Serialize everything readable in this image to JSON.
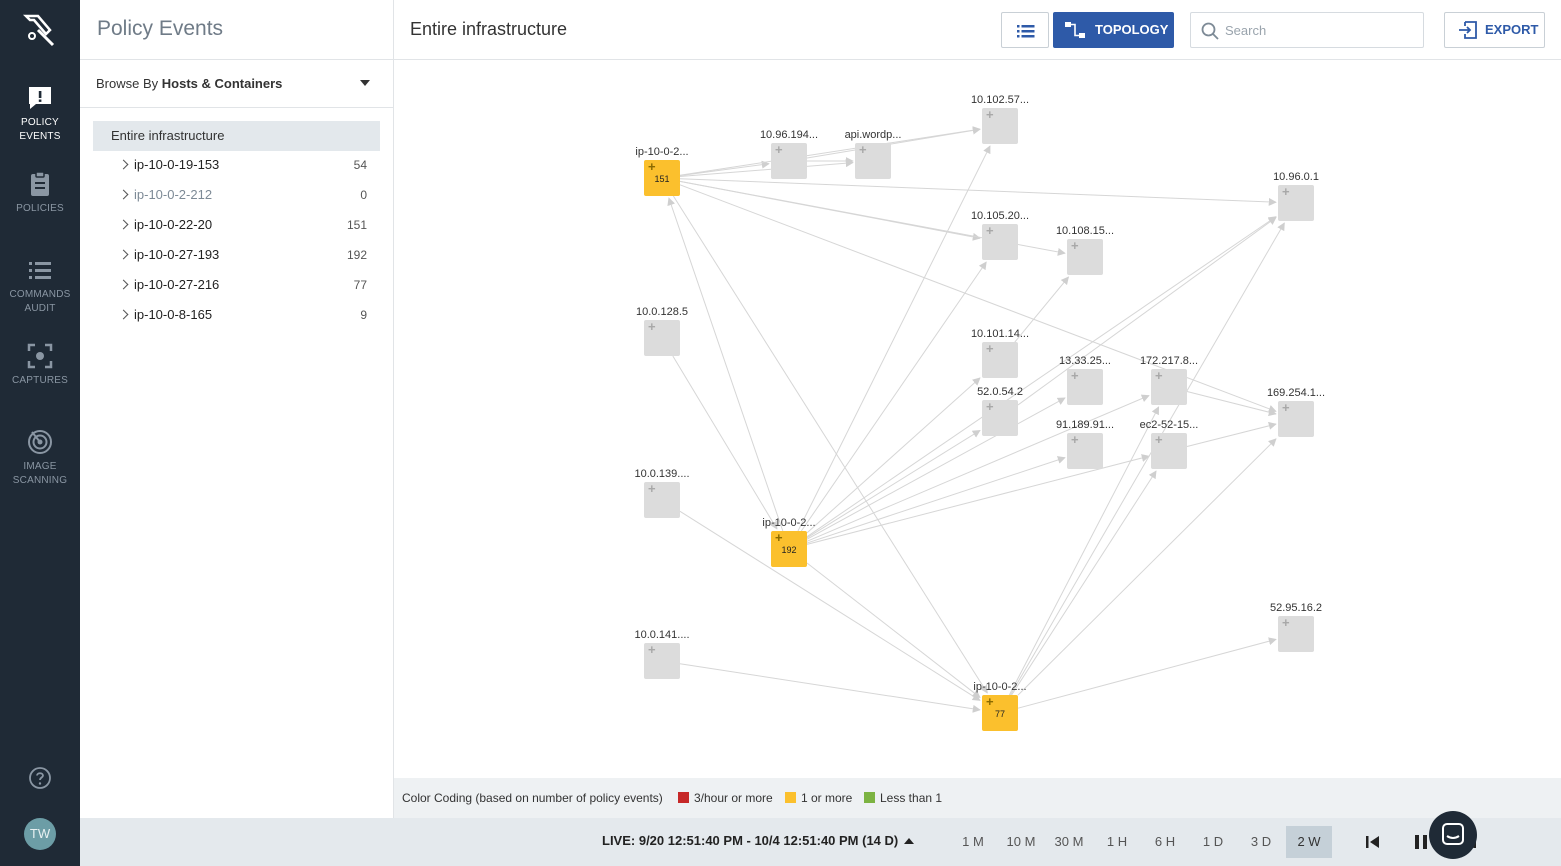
{
  "nav": {
    "items": [
      {
        "label1": "POLICY",
        "label2": "EVENTS",
        "icon": "alert-bubble-icon"
      },
      {
        "label1": "POLICIES",
        "label2": "",
        "icon": "clipboard-icon"
      },
      {
        "label1": "COMMANDS",
        "label2": "AUDIT",
        "icon": "list-icon"
      },
      {
        "label1": "CAPTURES",
        "label2": "",
        "icon": "capture-icon"
      },
      {
        "label1": "IMAGE",
        "label2": "SCANNING",
        "icon": "radar-icon"
      }
    ],
    "avatar": "TW",
    "help_icon": "help-circle-icon"
  },
  "sidebar": {
    "title": "Policy Events",
    "browse_prefix": "Browse By",
    "browse_value": "Hosts & Containers",
    "root": "Entire infrastructure",
    "items": [
      {
        "name": "ip-10-0-19-153",
        "count": "54"
      },
      {
        "name": "ip-10-0-2-212",
        "count": "0"
      },
      {
        "name": "ip-10-0-22-20",
        "count": "151"
      },
      {
        "name": "ip-10-0-27-193",
        "count": "192"
      },
      {
        "name": "ip-10-0-27-216",
        "count": "77"
      },
      {
        "name": "ip-10-0-8-165",
        "count": "9"
      }
    ]
  },
  "header": {
    "breadcrumb": "Entire infrastructure",
    "topology_label": "TOPOLOGY",
    "search_placeholder": "Search",
    "export_label": "EXPORT"
  },
  "colors": {
    "accent": "#2e5aa8",
    "event_node": "#fbc02d",
    "plain_node": "#dcdcdc",
    "red": "#c62828",
    "yellow": "#fbc02d",
    "green": "#7cb342"
  },
  "topology": {
    "nodes": [
      {
        "id": "n1",
        "label": "ip-10-0-2...",
        "count": "151",
        "type": "event"
      },
      {
        "id": "n2",
        "label": "10.96.194...",
        "count": "",
        "type": "plain"
      },
      {
        "id": "n3",
        "label": "api.wordp...",
        "count": "",
        "type": "plain"
      },
      {
        "id": "n4",
        "label": "10.102.57...",
        "count": "",
        "type": "plain"
      },
      {
        "id": "n5",
        "label": "10.96.0.1",
        "count": "",
        "type": "plain"
      },
      {
        "id": "n6",
        "label": "10.105.20...",
        "count": "",
        "type": "plain"
      },
      {
        "id": "n7",
        "label": "10.108.15...",
        "count": "",
        "type": "plain"
      },
      {
        "id": "n8",
        "label": "10.0.128.5",
        "count": "",
        "type": "plain"
      },
      {
        "id": "n9",
        "label": "10.101.14...",
        "count": "",
        "type": "plain"
      },
      {
        "id": "n10",
        "label": "13.33.25...",
        "count": "",
        "type": "plain"
      },
      {
        "id": "n11",
        "label": "172.217.8...",
        "count": "",
        "type": "plain"
      },
      {
        "id": "n12",
        "label": "169.254.1...",
        "count": "",
        "type": "plain"
      },
      {
        "id": "n13",
        "label": "52.0.54.2",
        "count": "",
        "type": "plain"
      },
      {
        "id": "n14",
        "label": "91.189.91...",
        "count": "",
        "type": "plain"
      },
      {
        "id": "n15",
        "label": "ec2-52-15...",
        "count": "",
        "type": "plain"
      },
      {
        "id": "n16",
        "label": "10.0.139....",
        "count": "",
        "type": "plain"
      },
      {
        "id": "n17",
        "label": "ip-10-0-2...",
        "count": "192",
        "type": "event"
      },
      {
        "id": "n18",
        "label": "10.0.141....",
        "count": "",
        "type": "plain"
      },
      {
        "id": "n19",
        "label": "ip-10-0-2...",
        "count": "77",
        "type": "event"
      },
      {
        "id": "n20",
        "label": "52.95.16.2",
        "count": "",
        "type": "plain"
      }
    ],
    "edges": [
      [
        "n1",
        "n2"
      ],
      [
        "n1",
        "n3"
      ],
      [
        "n1",
        "n4"
      ],
      [
        "n1",
        "n5"
      ],
      [
        "n1",
        "n6"
      ],
      [
        "n1",
        "n7"
      ],
      [
        "n1",
        "n12"
      ],
      [
        "n1",
        "n19"
      ],
      [
        "n2",
        "n3"
      ],
      [
        "n2",
        "n4"
      ],
      [
        "n8",
        "n17"
      ],
      [
        "n16",
        "n19"
      ],
      [
        "n17",
        "n1"
      ],
      [
        "n17",
        "n4"
      ],
      [
        "n17",
        "n6"
      ],
      [
        "n17",
        "n9"
      ],
      [
        "n17",
        "n13"
      ],
      [
        "n17",
        "n10"
      ],
      [
        "n17",
        "n14"
      ],
      [
        "n17",
        "n15"
      ],
      [
        "n17",
        "n11"
      ],
      [
        "n17",
        "n5"
      ],
      [
        "n17",
        "n19"
      ],
      [
        "n18",
        "n19"
      ],
      [
        "n9",
        "n7"
      ],
      [
        "n19",
        "n15"
      ],
      [
        "n19",
        "n11"
      ],
      [
        "n19",
        "n12"
      ],
      [
        "n19",
        "n5"
      ],
      [
        "n19",
        "n20"
      ],
      [
        "n15",
        "n12"
      ],
      [
        "n11",
        "n12"
      ],
      [
        "n13",
        "n5"
      ]
    ]
  },
  "legend": {
    "title": "Color Coding (based on number of policy events)",
    "items": [
      {
        "label": "3/hour or more",
        "color": "#c62828"
      },
      {
        "label": "1 or more",
        "color": "#fbc02d"
      },
      {
        "label": "Less than 1",
        "color": "#7cb342"
      }
    ]
  },
  "timebar": {
    "live": "LIVE: 9/20 12:51:40 PM - 10/4 12:51:40 PM (14 D)",
    "ranges": [
      "1 M",
      "10 M",
      "30 M",
      "1 H",
      "6 H",
      "1 D",
      "3 D",
      "2 W"
    ],
    "selected": "2 W"
  }
}
